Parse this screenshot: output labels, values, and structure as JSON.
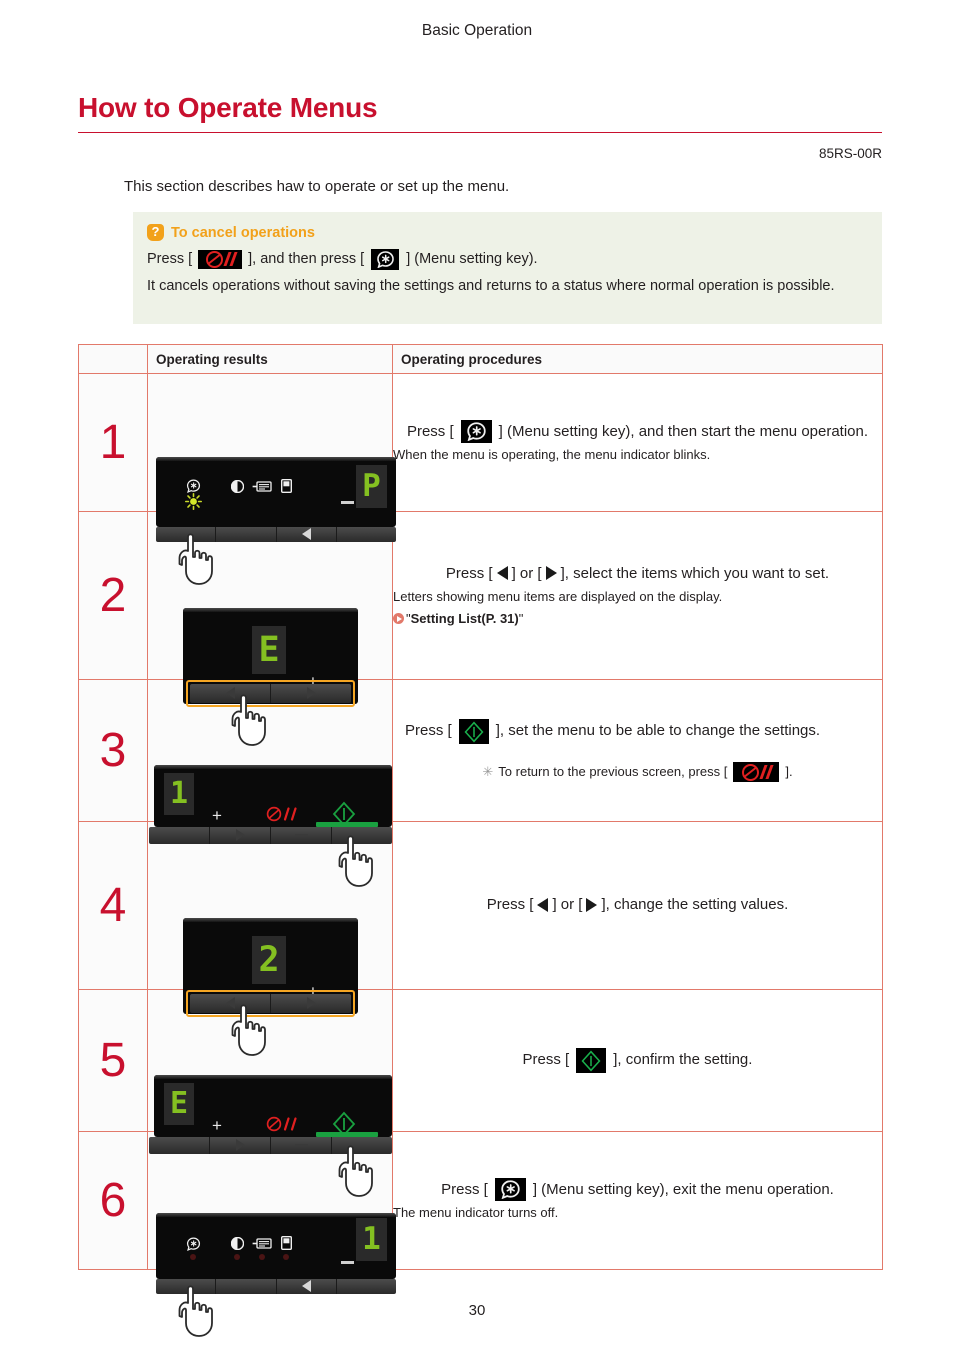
{
  "header": {
    "running_head": "Basic Operation"
  },
  "title": "How to Operate Menus",
  "doc_code": "85RS-00R",
  "intro": "This section describes haw to operate or set up the menu.",
  "callout": {
    "badge_icon": "question-badge-icon",
    "title": "To cancel operations",
    "line_pre": "Press [",
    "stop_icon": "stop-cancel-key-icon",
    "line_mid": "], and then press [",
    "menu_icon": "menu-setting-key-icon",
    "line_post": "] (Menu setting key).",
    "body": "It cancels operations without saving the settings and returns to a status where normal operation is possible."
  },
  "table": {
    "headers": {
      "num": "",
      "results": "Operating results",
      "procedures": "Operating procedures"
    },
    "rows": [
      {
        "num": "1",
        "display_value": "P",
        "main_pre": "Press [",
        "main_icon": "menu-setting-key-icon",
        "main_post": "] (Menu setting key), and then start the menu operation.",
        "sub": "When the menu is operating, the menu indicator blinks.",
        "note": "",
        "link": ""
      },
      {
        "num": "2",
        "display_value": "E",
        "main_pre": "Press [",
        "main_mid": "] or [",
        "main_post": "], select the items which you want to set.",
        "sub": "Letters showing menu items are displayed on the display.",
        "link_quote_open": "\"",
        "link_label": "Setting List(P. 31)",
        "link_quote_close": "\""
      },
      {
        "num": "3",
        "display_value": "1",
        "main_pre": "Press [",
        "main_icon": "ok-key-icon",
        "main_post": "], set the menu to be able to change the settings.",
        "note_pre": "To return to the previous screen, press [",
        "note_icon": "stop-cancel-key-icon",
        "note_post": "]."
      },
      {
        "num": "4",
        "display_value": "2",
        "main_pre": "Press [",
        "main_mid": "] or [",
        "main_post": "], change the setting values."
      },
      {
        "num": "5",
        "display_value": "E",
        "main_pre": "Press [",
        "main_icon": "ok-key-icon",
        "main_post": "], confirm the setting."
      },
      {
        "num": "6",
        "display_value": "1",
        "main_pre": "Press [",
        "main_icon": "menu-setting-key-icon",
        "main_post": "] (Menu setting key), exit the menu operation.",
        "sub": "The menu indicator turns off."
      }
    ]
  },
  "colors": {
    "title_red": "#c8102e",
    "table_border": "#e2796a",
    "callout_bg": "#eef2e7",
    "callout_accent": "#f2a11a",
    "segment_green": "#84c021",
    "highlight_orange": "#f5a623",
    "ok_green": "#1aa040",
    "stop_red": "#e02020"
  },
  "footer": {
    "page_number": "30"
  }
}
